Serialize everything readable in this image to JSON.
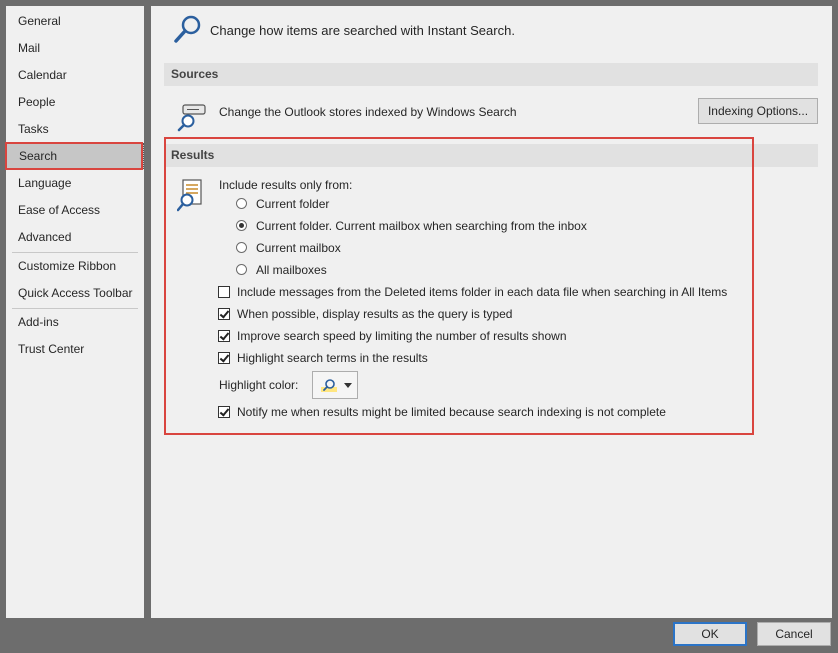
{
  "sidebar": {
    "items": [
      {
        "label": "General"
      },
      {
        "label": "Mail"
      },
      {
        "label": "Calendar"
      },
      {
        "label": "People"
      },
      {
        "label": "Tasks"
      },
      {
        "label": "Search",
        "selected": true
      },
      {
        "label": "Language"
      },
      {
        "label": "Ease of Access"
      },
      {
        "label": "Advanced"
      },
      {
        "label": "Customize Ribbon"
      },
      {
        "label": "Quick Access Toolbar"
      },
      {
        "label": "Add-ins"
      },
      {
        "label": "Trust Center"
      }
    ]
  },
  "header": {
    "icon": "magnifier-icon",
    "text": "Change how items are searched with Instant Search."
  },
  "sources": {
    "title": "Sources",
    "description": "Change the Outlook stores indexed by Windows Search",
    "button_label": "Indexing Options..."
  },
  "results": {
    "title": "Results",
    "include_label": "Include results only from:",
    "radio_options": [
      {
        "label": "Current folder",
        "selected": false
      },
      {
        "label": "Current folder. Current mailbox when searching from the inbox",
        "selected": true
      },
      {
        "label": "Current mailbox",
        "selected": false
      },
      {
        "label": "All mailboxes",
        "selected": false
      }
    ],
    "checkboxes": [
      {
        "label": "Include messages from the Deleted items folder in each data file when searching in All Items",
        "checked": false
      },
      {
        "label": "When possible, display results as the query is typed",
        "checked": true
      },
      {
        "label": "Improve search speed by limiting the number of results shown",
        "checked": true
      },
      {
        "label": "Highlight search terms in the results",
        "checked": true
      }
    ],
    "highlight_color_label": "Highlight color:",
    "highlight_color": "#ffe680",
    "notify_checkbox": {
      "label": "Notify me when results might be limited because search indexing is not complete",
      "checked": true
    }
  },
  "footer": {
    "ok_label": "OK",
    "cancel_label": "Cancel"
  },
  "colors": {
    "highlight_border": "#d9453f",
    "accent": "#2b74c7"
  }
}
